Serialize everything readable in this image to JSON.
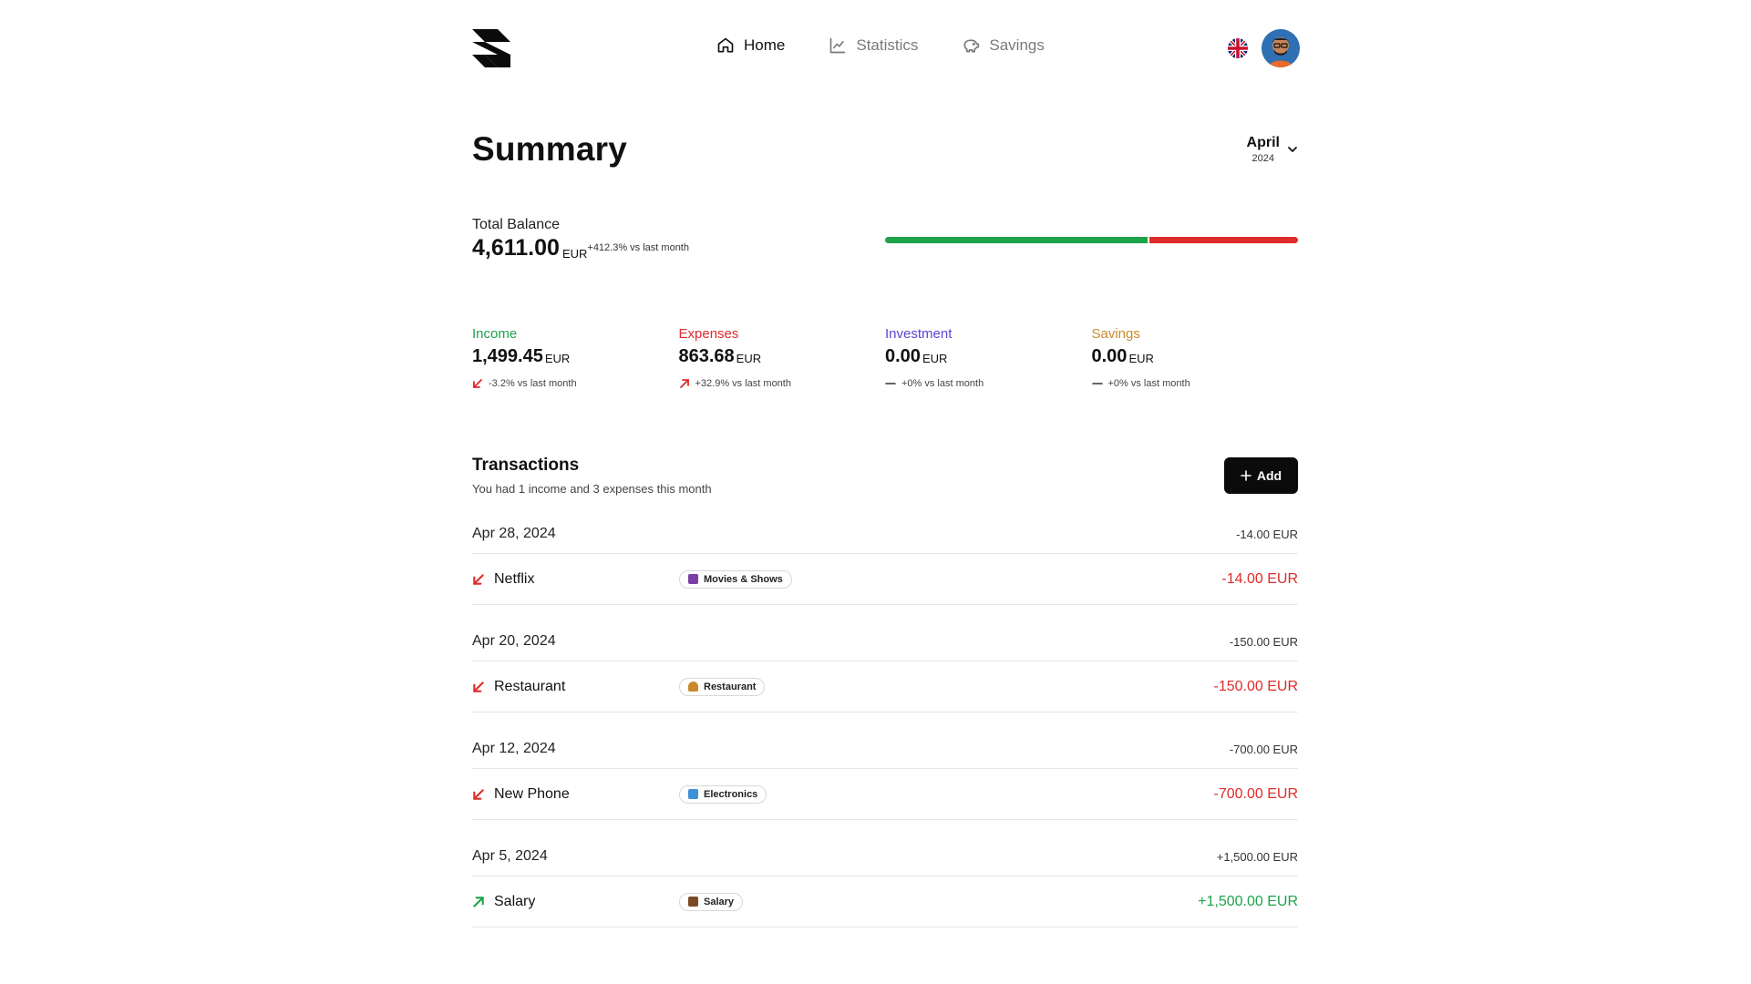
{
  "nav": {
    "items": [
      {
        "label": "Home",
        "icon": "home-icon",
        "active": true
      },
      {
        "label": "Statistics",
        "icon": "chart-line-icon",
        "active": false
      },
      {
        "label": "Savings",
        "icon": "piggy-bank-icon",
        "active": false
      }
    ]
  },
  "summary": {
    "title": "Summary",
    "month": "April",
    "year": "2024",
    "balance_label": "Total Balance",
    "balance_value": "4,611.00",
    "balance_currency": "EUR",
    "balance_change": "+412.3% vs last month",
    "balance_bar": {
      "income_fraction": 0.635,
      "income_color": "#1ea34a",
      "expense_color": "#de2b2b"
    }
  },
  "stats": [
    {
      "label": "Income",
      "value": "1,499.45",
      "currency": "EUR",
      "change": "-3.2% vs last month",
      "color": "#1ea34a",
      "trend": "down"
    },
    {
      "label": "Expenses",
      "value": "863.68",
      "currency": "EUR",
      "change": "+32.9% vs last month",
      "color": "#de2b2b",
      "trend": "up"
    },
    {
      "label": "Investment",
      "value": "0.00",
      "currency": "EUR",
      "change": "+0% vs last month",
      "color": "#5b46d6",
      "trend": "flat"
    },
    {
      "label": "Savings",
      "value": "0.00",
      "currency": "EUR",
      "change": "+0% vs last month",
      "color": "#c98a2a",
      "trend": "flat"
    }
  ],
  "transactions": {
    "title": "Transactions",
    "subtitle": "You had 1 income and 3 expenses this month",
    "add_label": "Add",
    "groups": [
      {
        "date": "Apr 28, 2024",
        "total": "-14.00 EUR",
        "name": "Netflix",
        "tag": "Movies & Shows",
        "tag_color": "#7b3fa8",
        "amount": "-14.00 EUR",
        "type": "expense"
      },
      {
        "date": "Apr 20, 2024",
        "total": "-150.00 EUR",
        "name": "Restaurant",
        "tag": "Restaurant",
        "tag_color": "#c9892a",
        "amount": "-150.00 EUR",
        "type": "expense"
      },
      {
        "date": "Apr 12, 2024",
        "total": "-700.00 EUR",
        "name": "New Phone",
        "tag": "Electronics",
        "tag_color": "#3d8fd6",
        "amount": "-700.00 EUR",
        "type": "expense"
      },
      {
        "date": "Apr 5, 2024",
        "total": "+1,500.00 EUR",
        "name": "Salary",
        "tag": "Salary",
        "tag_color": "#7a4a22",
        "amount": "+1,500.00 EUR",
        "type": "income"
      }
    ]
  }
}
